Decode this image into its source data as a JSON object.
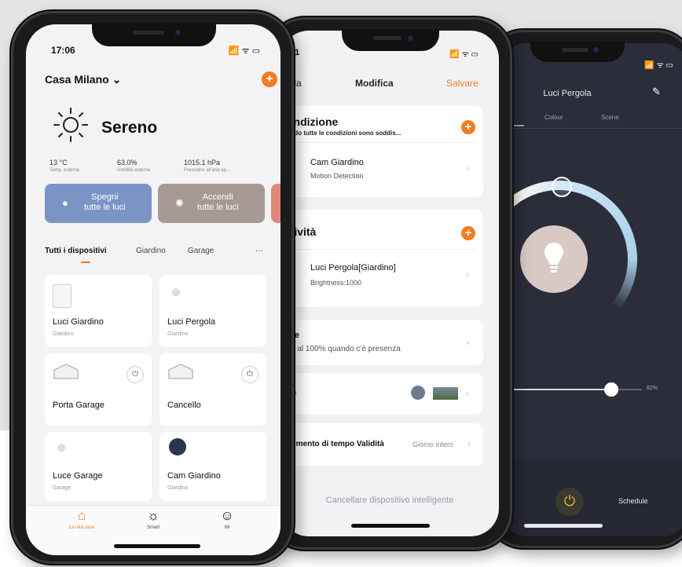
{
  "phone_front": {
    "status": {
      "time": "17:06",
      "signal": "📶 ᯤ ▭"
    },
    "home_name": "Casa Milano ⌄",
    "add_icon": "plus-icon",
    "weather": {
      "condition": "Sereno",
      "temperature": "13 °C",
      "temperature_label": "Temp. esterna",
      "humidity": "63.0%",
      "humidity_label": "Umidità esterna",
      "pressure": "1015.1 hPa",
      "pressure_label": "Pressione all'aria ap..."
    },
    "scenes": [
      {
        "line1": "Spegni",
        "line2": "tutte le luci",
        "color": "#7b94c6"
      },
      {
        "line1": "Accendi",
        "line2": "tutte le luci",
        "color": "#a79994"
      }
    ],
    "tabs": [
      "Tutti i dispositivi",
      "Giardino",
      "Garage",
      "···"
    ],
    "devices": [
      {
        "name": "Luci Giardino",
        "room": "Giardino"
      },
      {
        "name": "Luci Pergola",
        "room": "Giardino"
      },
      {
        "name": "Porta Garage",
        "room": ""
      },
      {
        "name": "Cancello",
        "room": ""
      },
      {
        "name": "Luce Garage",
        "room": "Garage"
      },
      {
        "name": "Cam Giardino",
        "room": "Giardino"
      }
    ],
    "bottom_nav": [
      {
        "label": "La mia casa",
        "icon": "home-icon"
      },
      {
        "label": "Smart",
        "icon": "sun-icon"
      },
      {
        "label": "Mi",
        "icon": "profile-icon"
      }
    ]
  },
  "phone_middle": {
    "status": {
      "time": "01",
      "signal": "📶 ᯤ ▭"
    },
    "nav": {
      "left": "ulla",
      "title": "Modifica",
      "right": "Salvare"
    },
    "condition": {
      "heading": "ondizione",
      "subtitle": "ando tutte le condizioni sono soddis...",
      "item_title": "Cam Giardino",
      "item_sub": "Motion Detection"
    },
    "activity": {
      "heading": "ttività",
      "item_title": "Luci Pergola[Giardino]",
      "item_sub": "Brightness:1000"
    },
    "name_row": {
      "title": "me",
      "sub": "ce al 100% quando c'è presenza"
    },
    "style_row": {
      "title": "ile"
    },
    "validity_row": {
      "title": "egmento di tempo Validità",
      "value": "Giorno intero"
    },
    "delete_label": "Cancellare dispositivo intelligente"
  },
  "phone_back": {
    "title": "Luci Pergola",
    "tabs": [
      "te",
      "Colour",
      "Scene"
    ],
    "slider_pct": "62%",
    "brightness_fraction": 0.62,
    "schedule_label": "Schedule"
  }
}
